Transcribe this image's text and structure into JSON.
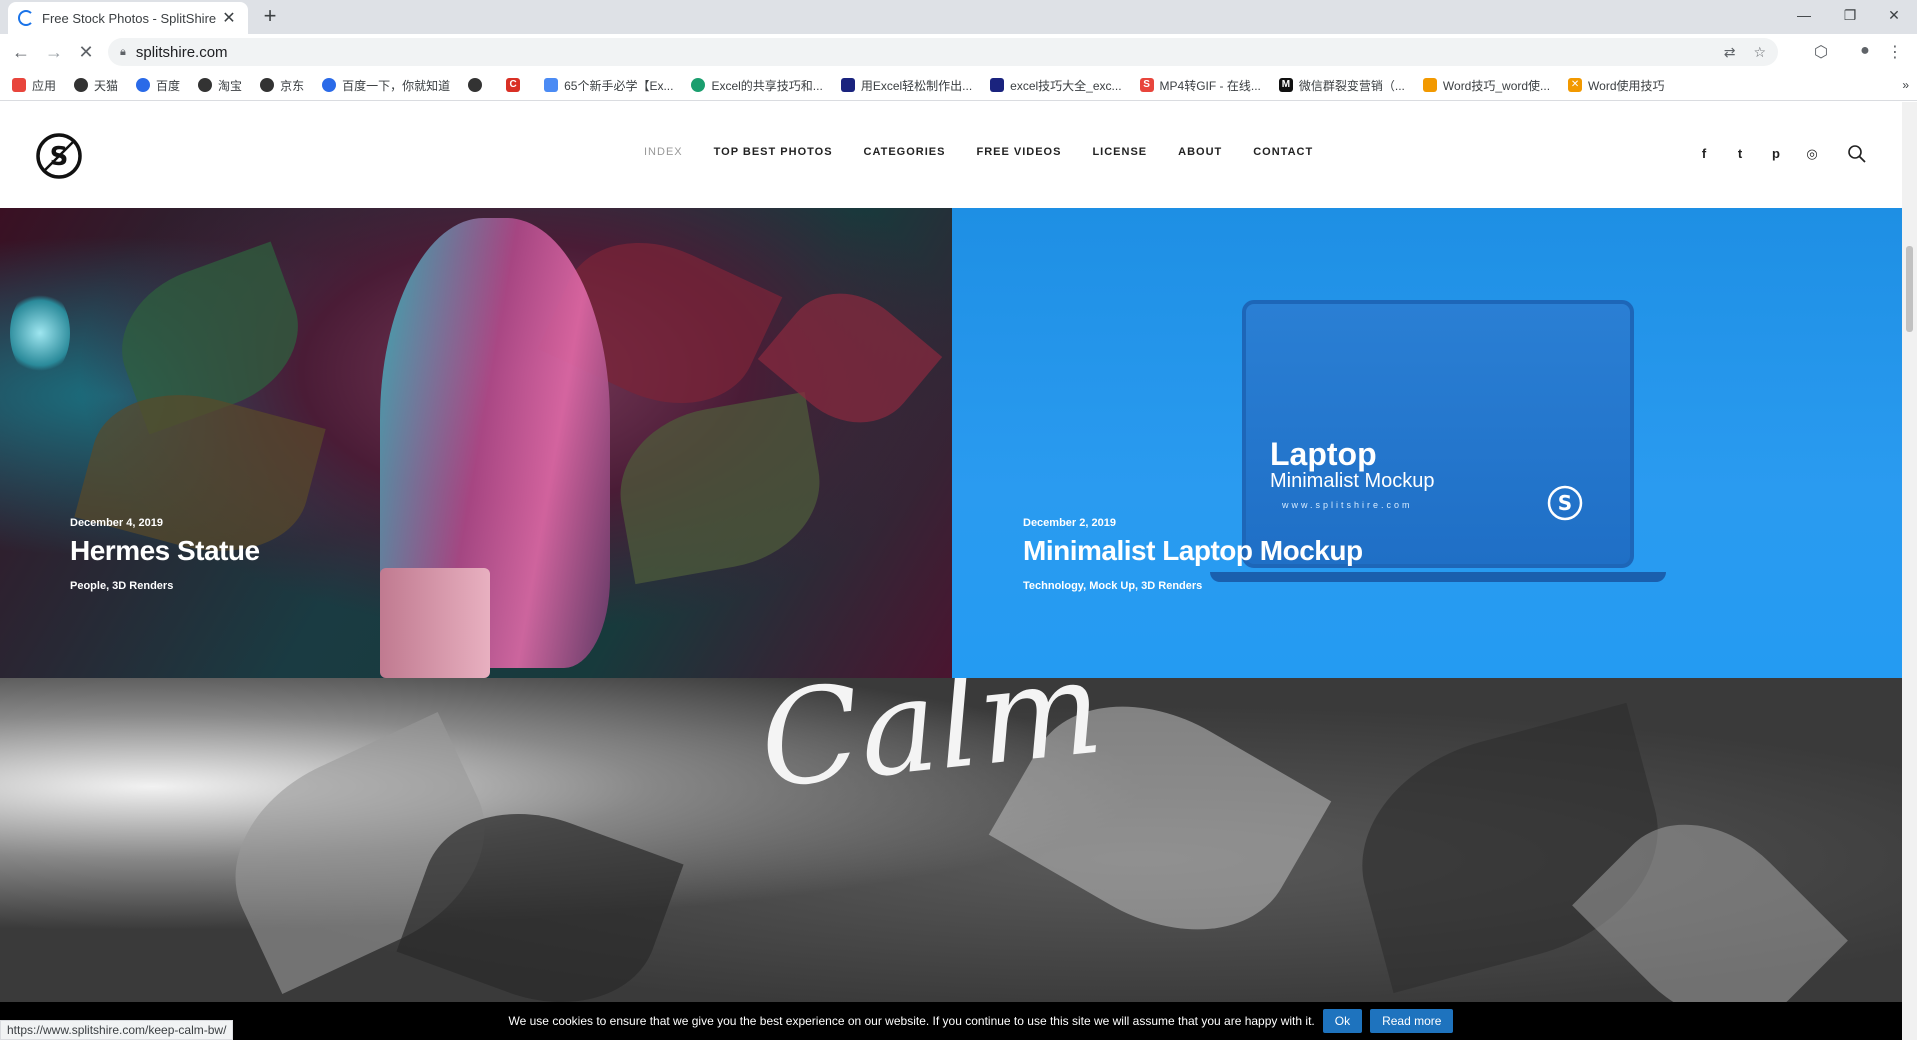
{
  "browser": {
    "tab_title": "Free Stock Photos - SplitShire",
    "tab_close": "✕",
    "new_tab": "+",
    "url": "splitshire.com",
    "status_url": "https://www.splitshire.com/keep-calm-bw/",
    "window": {
      "minimize": "—",
      "restore": "❐",
      "close": "✕"
    }
  },
  "bookmarks": [
    {
      "label": "应用",
      "color": "#e8453c"
    },
    {
      "label": "天猫",
      "color": "#333333"
    },
    {
      "label": "百度",
      "color": "#2a6ae8"
    },
    {
      "label": "淘宝",
      "color": "#333333"
    },
    {
      "label": "京东",
      "color": "#333333"
    },
    {
      "label": "百度一下，你就知道",
      "color": "#2a6ae8"
    },
    {
      "label": "",
      "color": "#333333"
    },
    {
      "label": "",
      "color": "#d93025"
    },
    {
      "label": "65个新手必学【Ex...",
      "color": "#4b8bf4"
    },
    {
      "label": "Excel的共享技巧和...",
      "color": "#1a9e6e"
    },
    {
      "label": "用Excel轻松制作出...",
      "color": "#1a237e"
    },
    {
      "label": "excel技巧大全_exc...",
      "color": "#1a237e"
    },
    {
      "label": "MP4转GIF - 在线...",
      "color": "#e8453c"
    },
    {
      "label": "微信群裂变营销（...",
      "color": "#111111"
    },
    {
      "label": "Word技巧_word使...",
      "color": "#f29900"
    },
    {
      "label": "Word使用技巧",
      "color": "#f29900"
    }
  ],
  "bookmarks_more": "»",
  "nav": {
    "items": [
      "INDEX",
      "TOP BEST PHOTOS",
      "CATEGORIES",
      "FREE VIDEOS",
      "LICENSE",
      "ABOUT",
      "CONTACT"
    ],
    "active": "INDEX"
  },
  "social": [
    "f",
    "t",
    "p",
    "◎"
  ],
  "cards": [
    {
      "date": "December 4, 2019",
      "title": "Hermes Statue",
      "categories": "People, 3D Renders"
    },
    {
      "date": "December 2, 2019",
      "title": "Minimalist Laptop Mockup",
      "categories": "Technology, Mock Up, 3D Renders"
    }
  ],
  "mockup": {
    "title": "Laptop",
    "subtitle": "Minimalist Mockup",
    "url": "www.splitshire.com"
  },
  "calm_text": "Calm",
  "cookie": {
    "text": "We use cookies to ensure that we give you the best experience on our website. If you continue to use this site we will assume that you are happy with it.",
    "ok": "Ok",
    "read_more": "Read more"
  },
  "colors": {
    "accent": "#1e73be",
    "card2_bg": "#249bf2"
  }
}
